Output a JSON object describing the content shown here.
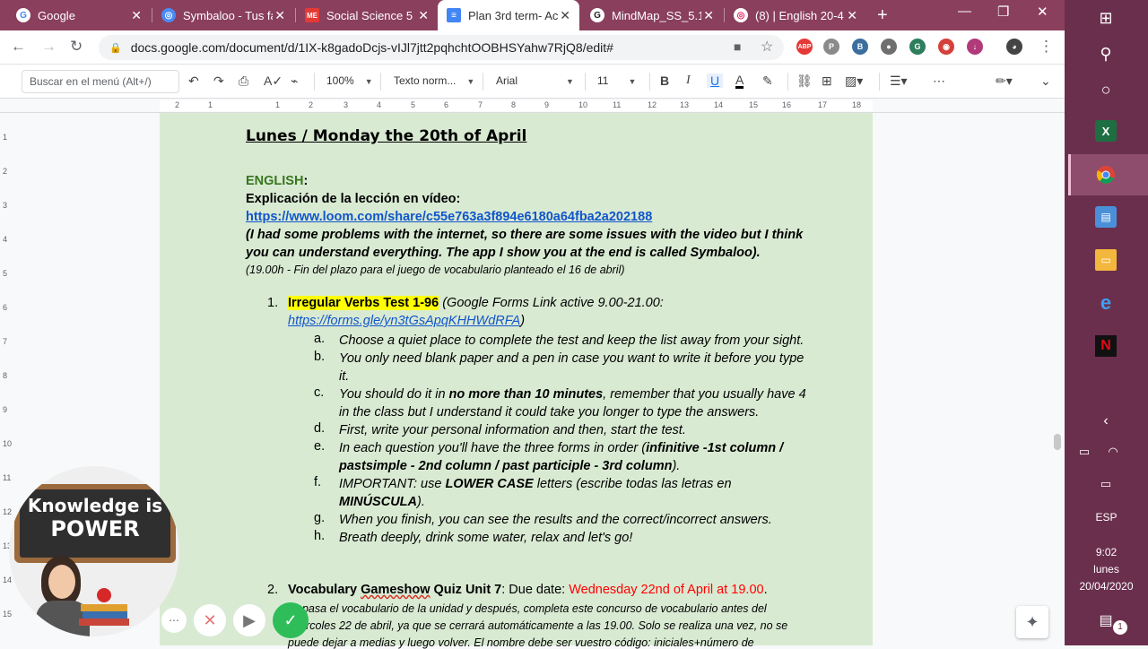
{
  "tabs": [
    {
      "title": "Google",
      "icon": "google-icon",
      "color": "#ffffff",
      "letter": "G"
    },
    {
      "title": "Symbaloo - Tus fa",
      "icon": "symbaloo-icon",
      "color": "#4a8af4",
      "letter": "◎"
    },
    {
      "title": "Social Science 5",
      "icon": "social-science-icon",
      "color": "#e53935",
      "letter": "ME"
    },
    {
      "title": "Plan 3rd term- Ac",
      "icon": "docs-icon",
      "color": "#4285f4",
      "letter": "≡"
    },
    {
      "title": "MindMap_SS_5.1_",
      "icon": "mindmap-icon",
      "color": "#222222",
      "letter": "G"
    },
    {
      "title": "(8) | English 20-4",
      "icon": "english-icon",
      "color": "#e91e63",
      "letter": "◎"
    }
  ],
  "address": {
    "url": "docs.google.com/document/d/1IX-k8gadoDcjs-vIJl7jtt2pqhchtOOBHSYahw7RjQ8/edit#"
  },
  "extensions": [
    {
      "name": "adblock-icon",
      "label": "ABP",
      "color": "#e53935"
    },
    {
      "name": "pinterest-icon",
      "label": "P",
      "color": "#8a8a8a"
    },
    {
      "name": "b-extension-icon",
      "label": "B",
      "color": "#3c6e9e"
    },
    {
      "name": "circle-extension-icon",
      "label": "●",
      "color": "#6f6f6f"
    },
    {
      "name": "grammarly-icon",
      "label": "G",
      "color": "#2e7d5b"
    },
    {
      "name": "color-extension-icon",
      "label": "◉",
      "color": "#d4403a"
    },
    {
      "name": "download-extension-icon",
      "label": "↓",
      "color": "#b03a7a"
    }
  ],
  "toolbar": {
    "menu_search_placeholder": "Buscar en el menú (Alt+/)",
    "zoom": "100%",
    "style": "Texto norm...",
    "font": "Arial",
    "size": "11"
  },
  "ruler": {
    "top_ticks": [
      "2",
      "1",
      "1",
      "2",
      "3",
      "4",
      "5",
      "6",
      "7",
      "8",
      "9",
      "10",
      "11",
      "12",
      "13",
      "14",
      "15",
      "16",
      "17",
      "18"
    ],
    "left_ticks": [
      "1",
      "2",
      "3",
      "4",
      "5",
      "6",
      "7",
      "8",
      "9",
      "10",
      "11",
      "12",
      "13",
      "14",
      "15"
    ]
  },
  "doc": {
    "heading": "Lunes / Monday the 20th of April",
    "english_label": "ENGLISH",
    "colon": ":",
    "explicacion": "Explicación de la lección en vídeo:",
    "loom_link": "https://www.loom.com/share/c55e763a3f894e6180a64fba2a202188",
    "note1": "(I had some problems with the internet, so there are some issues with the video but I think",
    "note2": "you can understand everything. The app I show you at the end is called Symbaloo).",
    "deadline": "(19.00h - Fin del plazo para el juego de vocabulario planteado el 16 de abril)",
    "item1_num": "1.",
    "item1_title": "Irregular Verbs Test 1-96",
    "item1_rest": " (Google Forms Link active 9.00-21.00:",
    "item1_link": "https://forms.gle/yn3tGsApqKHHWdRFA",
    "item1_close": ")",
    "sub": [
      {
        "letter": "a.",
        "lines": [
          "Choose a quiet place to complete the test and keep the list away from your sight."
        ]
      },
      {
        "letter": "b.",
        "lines": [
          "You only need blank paper and a pen in case you want to write it before you type",
          "it."
        ]
      },
      {
        "letter": "c.",
        "lines": [
          "You should do it in ",
          "no more than 10 minutes",
          ", remember that you usually have 4",
          "in the class but I understand it could take you longer to type the answers."
        ]
      },
      {
        "letter": "d.",
        "lines": [
          "First, write your personal information and then, start the test."
        ]
      },
      {
        "letter": "e.",
        "lines": [
          "In each question you'll have the three forms in order (",
          "infinitive -1st column / past",
          "simple - 2nd column / past participle - 3rd column",
          ")."
        ]
      },
      {
        "letter": "f.",
        "lines": [
          "IMPORTANT: use ",
          "LOWER CASE",
          " letters (escribe todas las letras en",
          "MINÚSCULA",
          ")."
        ]
      },
      {
        "letter": "g.",
        "lines": [
          "When you finish, you can see the results and the correct/incorrect answers."
        ]
      },
      {
        "letter": "h.",
        "lines": [
          "Breath deeply, drink some water, relax and let's go!"
        ]
      }
    ],
    "item2_num": "2.",
    "item2_title_a": "Vocabulary ",
    "item2_title_b": "Gameshow",
    "item2_title_c": " Quiz Unit 7",
    "item2_due": ": Due date: ",
    "item2_date": "Wednesday 22nd of April at 19.00",
    "item2_dot": ".",
    "item2_l1": "Repasa el vocabulario de la unidad y después, completa este concurso de vocabulario antes del",
    "item2_l2": "miércoles 22 de abril, ya que se cerrará automáticamente a las 19.00. Solo se realiza una vez, no se",
    "item2_l3": "puede dejar a medias y luego volver. El nombre debe ser vuestro código: iniciales+número de"
  },
  "webcam": {
    "line1": "Knowledge is",
    "line2": "POWER"
  },
  "taskbar": {
    "language": "ESP",
    "time": "9:02",
    "day": "lunes",
    "date": "20/04/2020",
    "notif_count": "1"
  },
  "colors": {
    "chrome_frame": "#8a3f5c",
    "page_bg": "#d9ead3",
    "english_green": "#38761d",
    "highlight": "#ffff00",
    "due_red": "#ff0000",
    "link_blue": "#1155cc",
    "taskbar": "#6b2f4e"
  }
}
